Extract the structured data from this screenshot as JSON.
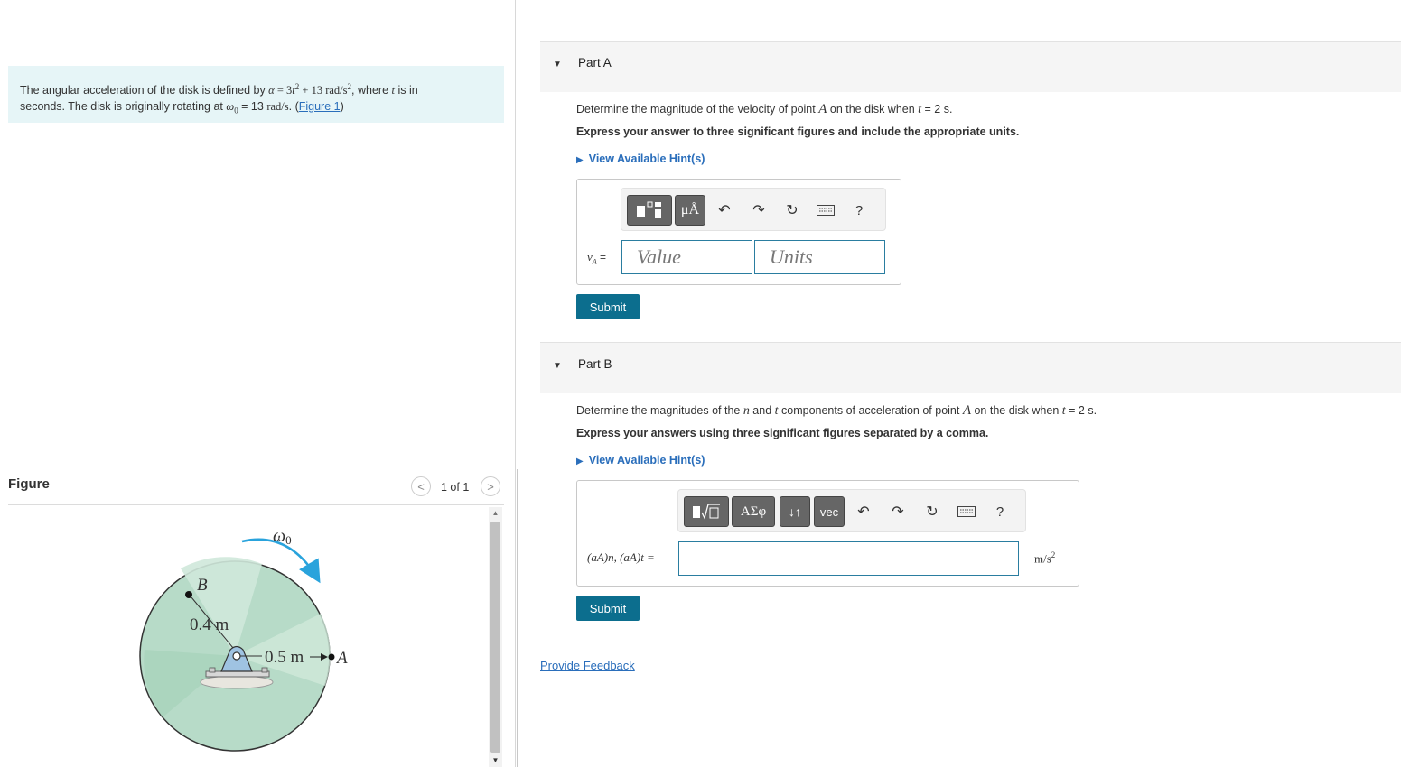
{
  "problem": {
    "text_1": "The angular acceleration of the disk is defined by ",
    "alpha": "α",
    "eq": " = 3",
    "t": "t",
    "sq": "2",
    "plus": " + 13 ",
    "rad": "rad/s",
    "sq2": "2",
    "text_2": ", where ",
    "t2": "t",
    "text_3": " is in",
    "text_4": "seconds. The disk is originally rotating at ",
    "omega0": "ω",
    "zero": "0",
    "text_5": " = 13 ",
    "rad2": "rad/s",
    "text_6": ". (",
    "figure_link": "Figure 1",
    "text_7": ")"
  },
  "figure": {
    "title": "Figure",
    "count": "1 of 1",
    "prev": "<",
    "next": ">",
    "labels": {
      "omega": "ω",
      "omega_sub": "0",
      "B": "B",
      "r1": "0.4 m",
      "r2": "0.5 m",
      "A": "A"
    }
  },
  "partA": {
    "label": "Part A",
    "q_1": "Determine the magnitude of the velocity of point ",
    "q_A": "A",
    "q_2": " on the disk when ",
    "q_t": "t",
    "q_3": " = 2 s.",
    "instruction": "Express your answer to three significant figures and include the appropriate units.",
    "hint": "View Available Hint(s)",
    "var_v": "v",
    "var_sub": "A",
    "var_eq": " =",
    "value_placeholder": "Value",
    "units_placeholder": "Units",
    "toolbar_mu": "μÅ",
    "help": "?",
    "submit": "Submit"
  },
  "partB": {
    "label": "Part B",
    "q_1": "Determine the magnitudes of the ",
    "q_n": "n",
    "q_2": " and ",
    "q_t": "t",
    "q_3": " components of acceleration of point ",
    "q_A": "A",
    "q_4": " on the disk when ",
    "q_t2": "t",
    "q_5": " = 2 s.",
    "instruction": "Express your answers using three significant figures separated by a comma.",
    "hint": "View Available Hint(s)",
    "var_label": "(aA)n, (aA)t =",
    "units": "m/s",
    "units_sup": "2",
    "toolbar_greek": "ΑΣφ",
    "toolbar_arrows": "↓↑",
    "toolbar_vec": "vec",
    "help": "?",
    "submit": "Submit"
  },
  "feedback": "Provide Feedback"
}
